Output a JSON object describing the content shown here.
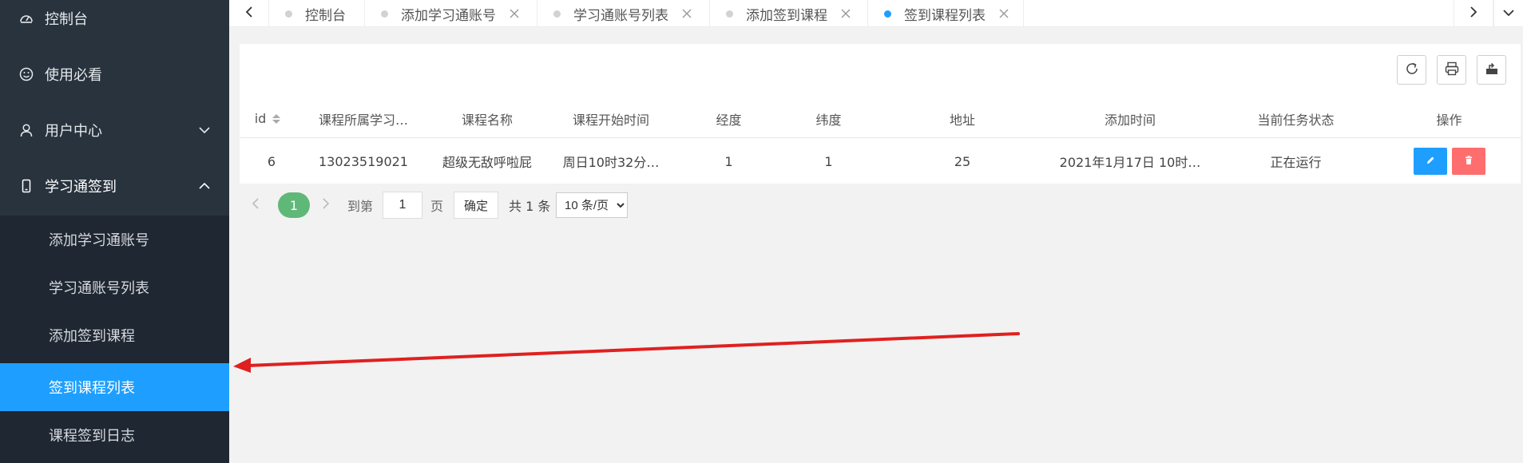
{
  "sidebar": {
    "items": [
      {
        "label": "控制台",
        "icon": "dashboard-icon"
      },
      {
        "label": "使用必看",
        "icon": "smile-icon"
      },
      {
        "label": "用户中心",
        "icon": "user-icon"
      },
      {
        "label": "学习通签到",
        "icon": "phone-icon"
      }
    ],
    "submenu": [
      {
        "label": "添加学习通账号"
      },
      {
        "label": "学习通账号列表"
      },
      {
        "label": "添加签到课程"
      },
      {
        "label": "签到课程列表"
      },
      {
        "label": "课程签到日志"
      }
    ]
  },
  "tabs": [
    {
      "label": "控制台"
    },
    {
      "label": "添加学习通账号"
    },
    {
      "label": "学习通账号列表"
    },
    {
      "label": "添加签到课程"
    },
    {
      "label": "签到课程列表"
    }
  ],
  "table": {
    "headers": [
      "id",
      "课程所属学习…",
      "课程名称",
      "课程开始时间",
      "经度",
      "纬度",
      "地址",
      "添加时间",
      "当前任务状态",
      "操作"
    ],
    "rows": [
      [
        "6",
        "13023519021",
        "超级无敌呼啦屁",
        "周日10时32分…",
        "1",
        "1",
        "25",
        "2021年1月17日 10时…",
        "正在运行"
      ]
    ]
  },
  "pagination": {
    "current": "1",
    "goto_label": "到第",
    "page_input": "1",
    "page_unit": "页",
    "confirm": "确定",
    "total": "共 1 条",
    "per_page": "10 条/页"
  },
  "colors": {
    "sidebar_bg": "#28333e",
    "submenu_bg": "#1f2732",
    "active": "#1e9fff",
    "pager_current": "#5fb878",
    "delete": "#ff5f5f",
    "annotation_arrow": "#e02020"
  }
}
